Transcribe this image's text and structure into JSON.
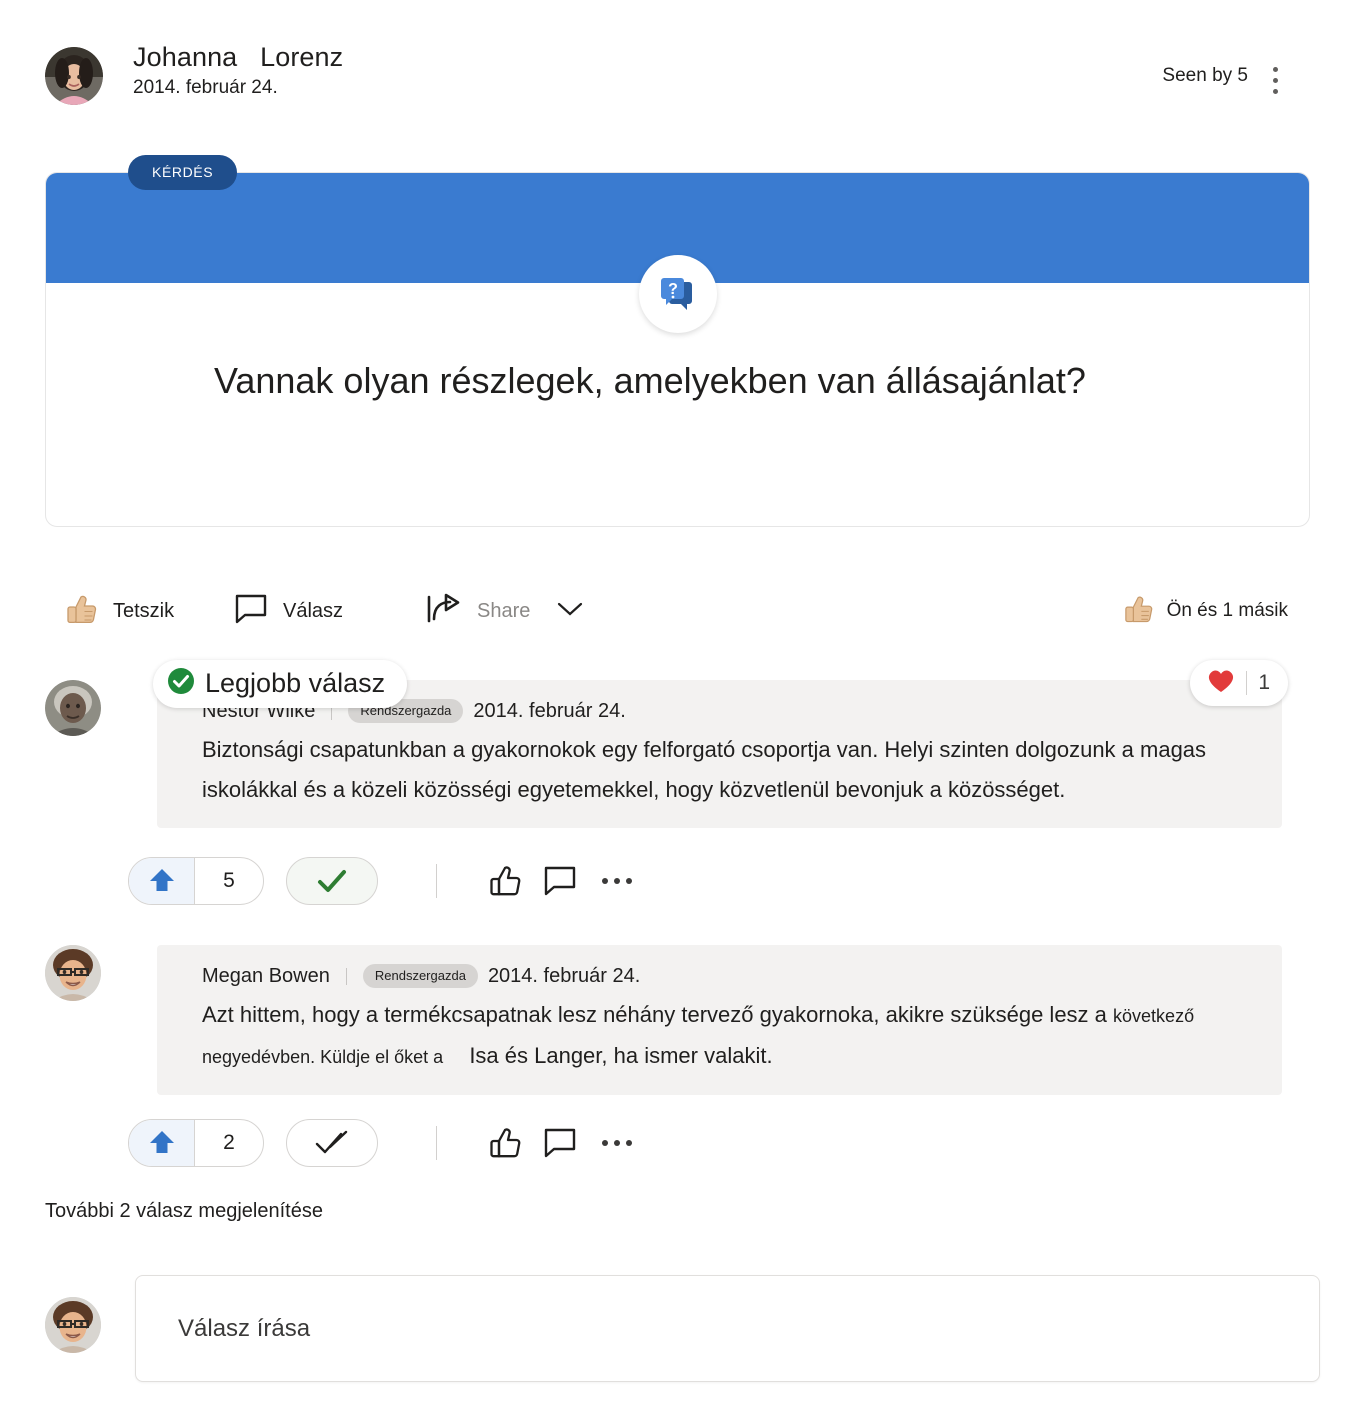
{
  "post": {
    "author_name": "Johanna   Lorenz",
    "date": "2014. február 24.",
    "seen_by": "Seen by 5",
    "more_icon": "more-vertical-icon",
    "badge": "KÉRDÉS",
    "question_icon": "question-chat-icon",
    "question_text": "Vannak olyan részlegek, amelyekben van állásajánlat?"
  },
  "actions": {
    "like_label": "Tetszik",
    "reply_label": "Válasz",
    "share_label": "Share",
    "likes_summary": "Ön és 1 másik",
    "like_icon": "thumbs-up-icon",
    "reply_icon": "comment-icon",
    "share_icon": "share-icon",
    "chevron_icon": "chevron-down-icon"
  },
  "best_answer_label": "Legjobb válasz",
  "replies": [
    {
      "author": "Nestor Wilke",
      "role": "Rendszergazda",
      "date": "2014. február 24.",
      "text": "Biztonsági csapatunkban a gyakornokok egy felforgató csoportja van. Helyi szinten dolgozunk a magas iskolákkal és a közeli közösségi egyetemekkel, hogy közvetlenül bevonjuk a közösséget.",
      "upvotes": "5",
      "reaction_count": "1",
      "reaction_icon": "heart-icon",
      "best_answer": true,
      "marked_answer": true
    },
    {
      "author": "Megan Bowen",
      "role": "Rendszergazda",
      "date": "2014. február 24.",
      "text_part1": "Azt hittem, hogy a termékcsapatnak lesz néhány tervező gyakornoka, akikre szüksége lesz a",
      "text_small": "következő negyedévben. Küldje el őket a",
      "text_mention": "Isa és Langer, ha ismer valakit.",
      "upvotes": "2",
      "best_answer": false,
      "marked_answer": false
    }
  ],
  "show_more_label": "További 2 válasz megjelenítése",
  "composer": {
    "placeholder": "Válasz írása"
  },
  "colors": {
    "card_header_blue": "#3a7bd0",
    "badge_blue": "#1f4e8c",
    "upvote_blue": "#3274c7",
    "check_green": "#2e7d32",
    "heart_red": "#e03c3c",
    "bubble_grey": "#f3f2f1"
  }
}
